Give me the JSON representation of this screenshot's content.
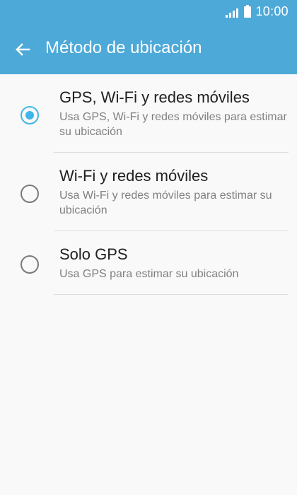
{
  "status_bar": {
    "time": "10:00",
    "signal_icon": "signal-icon",
    "battery_icon": "battery-icon"
  },
  "toolbar": {
    "back_icon": "back-arrow-icon",
    "title": "Método de ubicación"
  },
  "options": [
    {
      "title": "GPS, Wi-Fi y redes móviles",
      "description": "Usa GPS, Wi-Fi y redes móviles para estimar su ubicación",
      "selected": true
    },
    {
      "title": "Wi-Fi y redes móviles",
      "description": "Usa Wi-Fi y redes móviles para estimar su ubicación",
      "selected": false
    },
    {
      "title": "Solo GPS",
      "description": "Usa GPS para estimar su ubicación",
      "selected": false
    }
  ],
  "colors": {
    "header": "#4da9d8",
    "accent": "#3fb6e8",
    "background": "#f9f9f9"
  }
}
